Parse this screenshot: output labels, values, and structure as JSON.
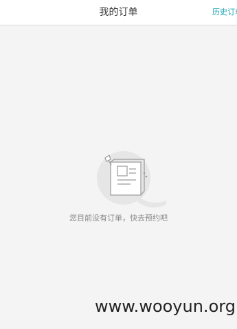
{
  "header": {
    "title": "我的订单",
    "history_label": "历史订单"
  },
  "empty_state": {
    "message": "您目前没有订单，快去预约吧",
    "illustration_icon": "empty-orders-icon"
  },
  "watermark": {
    "text": "www.wooyun.org"
  },
  "colors": {
    "accent": "#1aa3b4",
    "background": "#f4f4f4"
  }
}
